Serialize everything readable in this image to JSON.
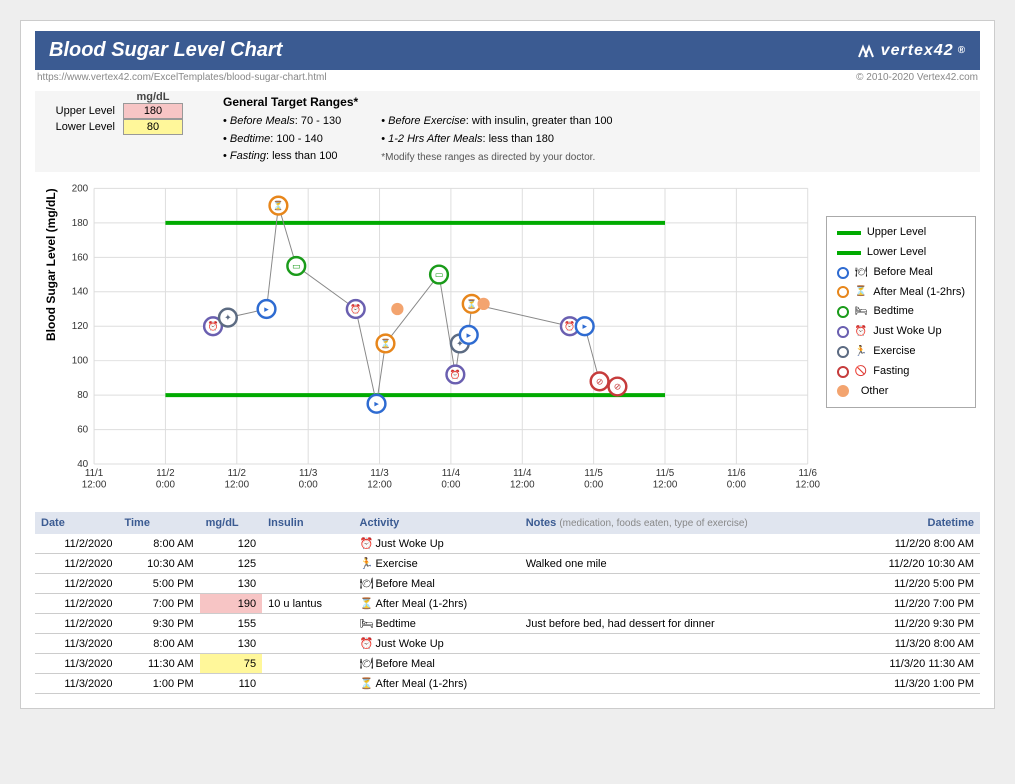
{
  "header": {
    "title": "Blood Sugar Level Chart",
    "brand": "vertex42",
    "url": "https://www.vertex42.com/ExcelTemplates/blood-sugar-chart.html",
    "copyright": "© 2010-2020 Vertex42.com"
  },
  "levels": {
    "unit": "mg/dL",
    "upper_label": "Upper Level",
    "upper_value": "180",
    "lower_label": "Lower Level",
    "lower_value": "80"
  },
  "ranges": {
    "title": "General Target Ranges*",
    "col1": [
      {
        "label": "Before Meals",
        "text": ": 70 - 130"
      },
      {
        "label": "Bedtime",
        "text": ": 100 - 140"
      },
      {
        "label": "Fasting",
        "text": ": less than 100"
      }
    ],
    "col2": [
      {
        "label": "Before Exercise",
        "text": ": with insulin, greater than 100"
      },
      {
        "label": "1-2 Hrs After Meals",
        "text": ": less than 180"
      }
    ],
    "footnote": "*Modify these ranges as directed by your doctor."
  },
  "chart_data": {
    "type": "scatter",
    "ylabel": "Blood Sugar Level (mg/dL)",
    "ylim": [
      40,
      200
    ],
    "upper_level": 180,
    "lower_level": 80,
    "x_ticks": [
      "11/1\n12:00",
      "11/2\n0:00",
      "11/2\n12:00",
      "11/3\n0:00",
      "11/3\n12:00",
      "11/4\n0:00",
      "11/4\n12:00",
      "11/5\n0:00",
      "11/5\n12:00",
      "11/6\n0:00",
      "11/6\n12:00"
    ],
    "legend": [
      {
        "type": "line",
        "label": "Upper Level"
      },
      {
        "type": "line",
        "label": "Lower Level"
      },
      {
        "color": "#2e6bd1",
        "icon": "🍽",
        "label": "Before Meal"
      },
      {
        "color": "#e7861b",
        "icon": "⏳",
        "label": "After Meal (1-2hrs)"
      },
      {
        "color": "#1a9b1a",
        "icon": "🛏",
        "label": "Bedtime"
      },
      {
        "color": "#6a5fb0",
        "icon": "⏰",
        "label": "Just Woke Up"
      },
      {
        "color": "#5c6b82",
        "icon": "🏃",
        "label": "Exercise"
      },
      {
        "color": "#c63c3c",
        "icon": "🚫",
        "label": "Fasting"
      },
      {
        "color": "#f3a46f",
        "icon": "",
        "label": "Other",
        "solid": true
      }
    ],
    "x_range": [
      0,
      120
    ],
    "series_path_x": [
      20,
      22.5,
      29,
      31,
      34,
      44,
      47.5,
      49,
      58,
      60.75,
      61.5,
      63,
      80,
      82.5,
      85,
      88,
      92,
      94
    ],
    "points": [
      {
        "x": 20,
        "y": 120,
        "cat": "wokeup"
      },
      {
        "x": 22.5,
        "y": 125,
        "cat": "exercise"
      },
      {
        "x": 29,
        "y": 130,
        "cat": "before"
      },
      {
        "x": 31,
        "y": 190,
        "cat": "after"
      },
      {
        "x": 34,
        "y": 155,
        "cat": "bedtime"
      },
      {
        "x": 44,
        "y": 130,
        "cat": "wokeup"
      },
      {
        "x": 47.5,
        "y": 75,
        "cat": "before"
      },
      {
        "x": 49,
        "y": 110,
        "cat": "after"
      },
      {
        "x": 51,
        "y": 130,
        "cat": "other"
      },
      {
        "x": 58,
        "y": 150,
        "cat": "bedtime"
      },
      {
        "x": 60.75,
        "y": 92,
        "cat": "wokeup"
      },
      {
        "x": 61.5,
        "y": 110,
        "cat": "exercise"
      },
      {
        "x": 63,
        "y": 115,
        "cat": "before"
      },
      {
        "x": 63.5,
        "y": 133,
        "cat": "after"
      },
      {
        "x": 65.5,
        "y": 133,
        "cat": "other"
      },
      {
        "x": 80,
        "y": 120,
        "cat": "wokeup"
      },
      {
        "x": 82.5,
        "y": 120,
        "cat": "before"
      },
      {
        "x": 85,
        "y": 88,
        "cat": "fasting"
      },
      {
        "x": 88,
        "y": 85,
        "cat": "fasting"
      }
    ],
    "categories": {
      "before": {
        "stroke": "#2e6bd1"
      },
      "after": {
        "stroke": "#e7861b"
      },
      "bedtime": {
        "stroke": "#1a9b1a"
      },
      "wokeup": {
        "stroke": "#6a5fb0"
      },
      "exercise": {
        "stroke": "#5c6b82"
      },
      "fasting": {
        "stroke": "#c63c3c"
      },
      "other": {
        "stroke": "#f3a46f",
        "solid": true,
        "small": true
      }
    }
  },
  "table": {
    "headers": [
      "Date",
      "Time",
      "mg/dL",
      "Insulin",
      "Activity",
      "Notes",
      "Datetime"
    ],
    "notes_hint": "(medication, foods eaten, type of exercise)",
    "rows": [
      {
        "date": "11/2/2020",
        "time": "8:00 AM",
        "mgdl": "120",
        "insulin": "",
        "act_icon": "⏰",
        "activity": "Just Woke Up",
        "notes": "",
        "dt": "11/2/20 8:00 AM"
      },
      {
        "date": "11/2/2020",
        "time": "10:30 AM",
        "mgdl": "125",
        "insulin": "",
        "act_icon": "🏃",
        "activity": "Exercise",
        "notes": "Walked one mile",
        "dt": "11/2/20 10:30 AM"
      },
      {
        "date": "11/2/2020",
        "time": "5:00 PM",
        "mgdl": "130",
        "insulin": "",
        "act_icon": "🍽",
        "activity": "Before Meal",
        "notes": "",
        "dt": "11/2/20 5:00 PM"
      },
      {
        "date": "11/2/2020",
        "time": "7:00 PM",
        "mgdl": "190",
        "mgdl_class": "cell-pink",
        "insulin": "10 u lantus",
        "act_icon": "⏳",
        "activity": "After Meal (1-2hrs)",
        "notes": "",
        "dt": "11/2/20 7:00 PM"
      },
      {
        "date": "11/2/2020",
        "time": "9:30 PM",
        "mgdl": "155",
        "insulin": "",
        "act_icon": "🛏",
        "activity": "Bedtime",
        "notes": "Just before bed, had dessert for dinner",
        "dt": "11/2/20 9:30 PM"
      },
      {
        "date": "11/3/2020",
        "time": "8:00 AM",
        "mgdl": "130",
        "insulin": "",
        "act_icon": "⏰",
        "activity": "Just Woke Up",
        "notes": "",
        "dt": "11/3/20 8:00 AM"
      },
      {
        "date": "11/3/2020",
        "time": "11:30 AM",
        "mgdl": "75",
        "mgdl_class": "cell-yellow",
        "insulin": "",
        "act_icon": "🍽",
        "activity": "Before Meal",
        "notes": "",
        "dt": "11/3/20 11:30 AM"
      },
      {
        "date": "11/3/2020",
        "time": "1:00 PM",
        "mgdl": "110",
        "insulin": "",
        "act_icon": "⏳",
        "activity": "After Meal (1-2hrs)",
        "notes": "",
        "dt": "11/3/20 1:00 PM"
      }
    ]
  }
}
